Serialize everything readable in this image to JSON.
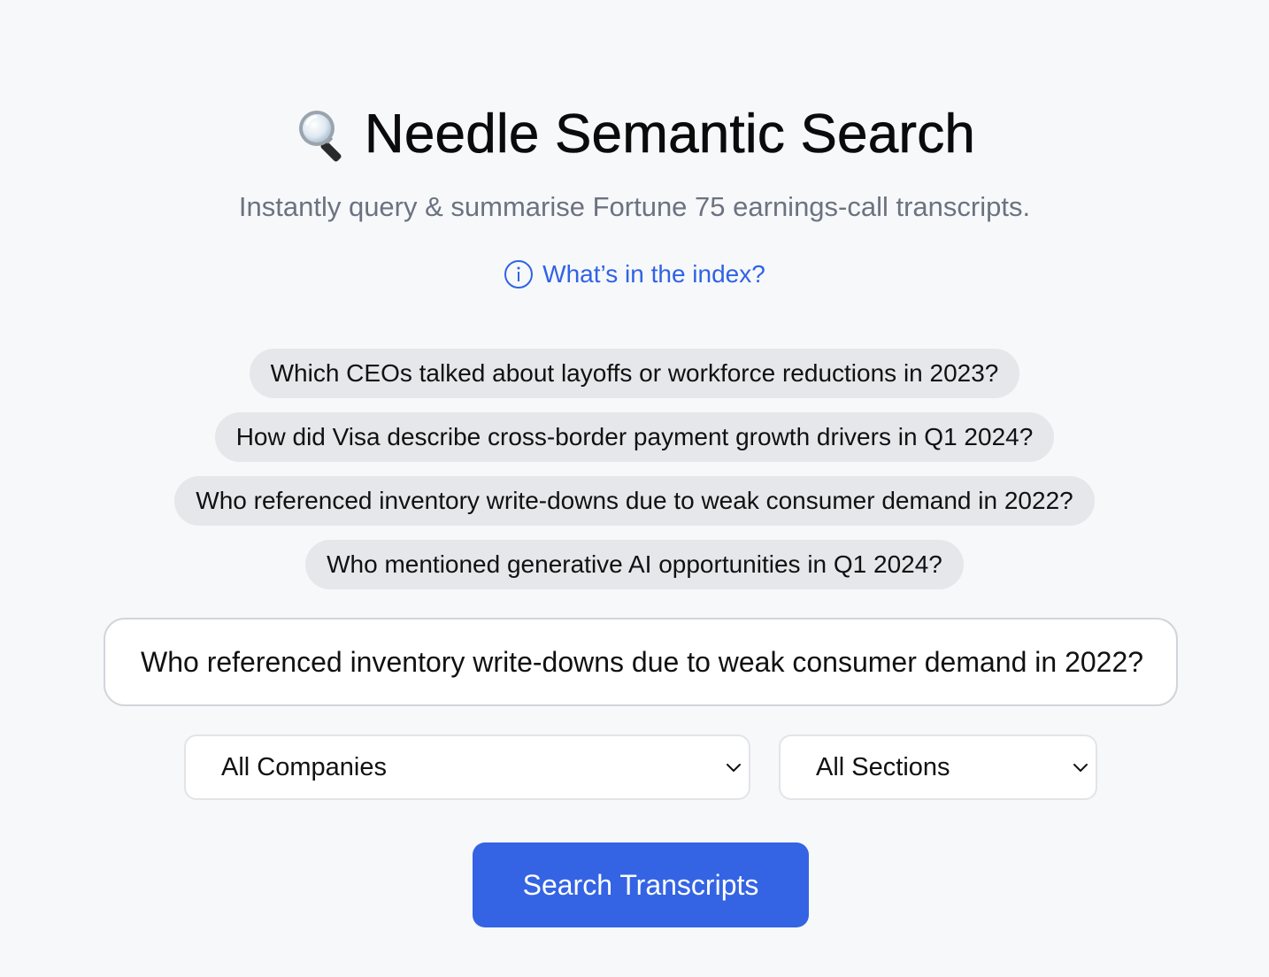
{
  "header": {
    "title": "Needle Semantic Search",
    "title_icon": "magnifying-glass-icon",
    "subtitle": "Instantly query & summarise Fortune 75 earnings-call transcripts."
  },
  "index_link": {
    "icon": "info-icon",
    "label": "What’s in the index?"
  },
  "suggestions": [
    "Which CEOs talked about layoffs or workforce reductions in 2023?",
    "How did Visa describe cross-border payment growth drivers in Q1 2024?",
    "Who referenced inventory write-downs due to weak consumer demand in 2022?",
    "Who mentioned generative AI opportunities in Q1 2024?"
  ],
  "query": {
    "value": "Who referenced inventory write-downs due to weak consumer demand in 2022?"
  },
  "filters": {
    "company": "All Companies",
    "section": "All Sections"
  },
  "search_button": {
    "label": "Search Transcripts"
  },
  "colors": {
    "background": "#f7f8fa",
    "accent": "#3464e4",
    "link": "#2f62e6",
    "chip": "#e5e7eb",
    "muted_text": "#6b7280"
  }
}
